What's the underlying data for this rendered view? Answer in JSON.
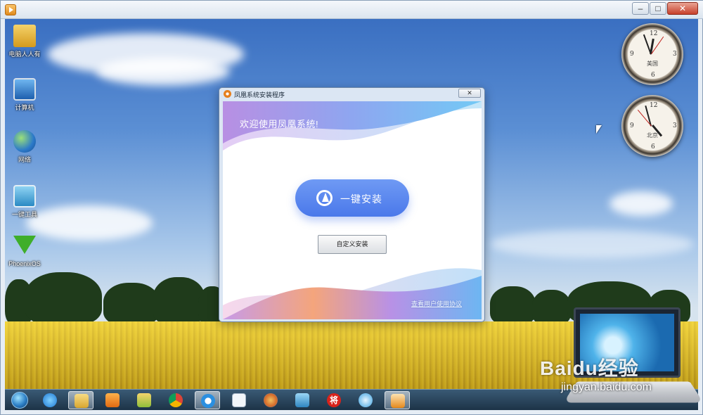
{
  "desktop_icons": [
    {
      "label": "电脑人人有",
      "icon": "user-folder-icon"
    },
    {
      "label": "计算机",
      "icon": "computer-icon"
    },
    {
      "label": "网络",
      "icon": "network-icon"
    },
    {
      "label": "一键工具",
      "icon": "management-icon"
    },
    {
      "label": "PhoenixOS",
      "icon": "download-arrow-icon"
    }
  ],
  "clocks": [
    {
      "label": "美国"
    },
    {
      "label": "北京"
    }
  ],
  "installer": {
    "title": "凤凰系统安装程序",
    "close": "✕",
    "welcome": "欢迎使用凤凰系统!",
    "install_button": "一键安装",
    "custom_button": "自定义安装",
    "agreement_link": "查看用户使用协议",
    "colors": {
      "primary": "#5a86ee",
      "wave_purple": "#a98ee6",
      "wave_blue": "#6fc3f5",
      "wave_orange": "#f9a36b"
    }
  },
  "taskbar": {
    "items": [
      "start-orb-icon",
      "ie-icon",
      "explorer-icon",
      "media-player-icon",
      "folder-icon",
      "chrome-icon",
      "app-icon",
      "document-icon",
      "paint-icon",
      "remote-desktop-icon",
      "jiang-icon",
      "app-icon-2",
      "installer-icon"
    ],
    "jiang_label": "将"
  },
  "watermark": {
    "logo": "Baidu经验",
    "url": "jingyan.baidu.com"
  }
}
